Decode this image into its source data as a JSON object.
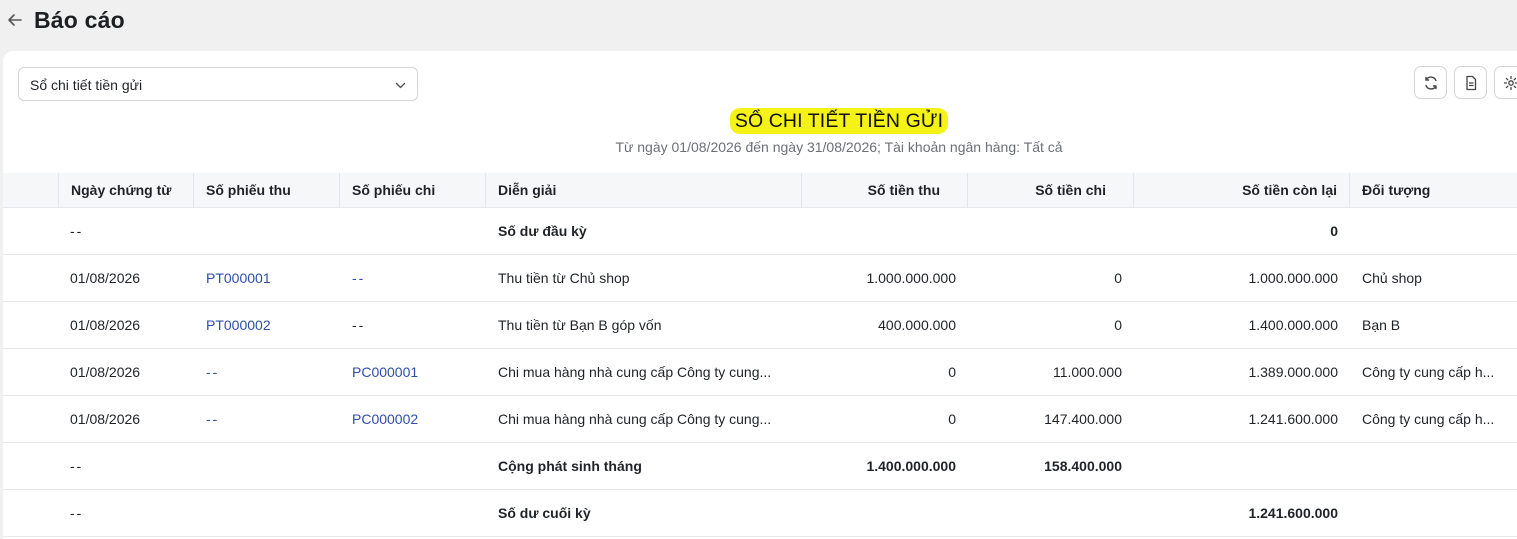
{
  "header": {
    "title": "Báo cáo"
  },
  "toolbar": {
    "report_select_value": "Sổ chi tiết tiền gửi"
  },
  "report": {
    "title": "SỔ CHI TIẾT TIỀN GỬI",
    "subtitle": "Từ ngày 01/08/2026 đến ngày 31/08/2026; Tài khoản ngân hàng: Tất cả",
    "highlight_color": "#f5f215"
  },
  "table": {
    "columns": {
      "date": "Ngày chứng từ",
      "receipt_no": "Số phiếu thu",
      "payment_no": "Số phiếu chi",
      "description": "Diễn giải",
      "amount_in": "Số tiền thu",
      "amount_out": "Số tiền chi",
      "balance": "Số tiền còn lại",
      "party": "Đối tượng"
    },
    "rows": [
      {
        "date": "--",
        "receipt_no": "",
        "payment_no": "",
        "description": "Số dư đầu kỳ",
        "amount_in": "",
        "amount_out": "",
        "balance": "0",
        "party": ""
      },
      {
        "date": "01/08/2026",
        "receipt_no": "PT000001",
        "payment_no": "--",
        "description": "Thu tiền từ Chủ shop",
        "amount_in": "1.000.000.000",
        "amount_out": "0",
        "balance": "1.000.000.000",
        "party": "Chủ shop"
      },
      {
        "date": "01/08/2026",
        "receipt_no": "PT000002",
        "payment_no": "--",
        "description": "Thu tiền từ Bạn B góp vốn",
        "amount_in": "400.000.000",
        "amount_out": "0",
        "balance": "1.400.000.000",
        "party": "Bạn B"
      },
      {
        "date": "01/08/2026",
        "receipt_no": "--",
        "payment_no": "PC000001",
        "description": "Chi mua hàng nhà cung cấp Công ty cung...",
        "amount_in": "0",
        "amount_out": "11.000.000",
        "balance": "1.389.000.000",
        "party": "Công ty cung cấp h..."
      },
      {
        "date": "01/08/2026",
        "receipt_no": "--",
        "payment_no": "PC000002",
        "description": "Chi mua hàng nhà cung cấp Công ty cung...",
        "amount_in": "0",
        "amount_out": "147.400.000",
        "balance": "1.241.600.000",
        "party": "Công ty cung cấp h..."
      },
      {
        "date": "--",
        "receipt_no": "",
        "payment_no": "",
        "description": "Cộng phát sinh tháng",
        "amount_in": "1.400.000.000",
        "amount_out": "158.400.000",
        "balance": "",
        "party": ""
      },
      {
        "date": "--",
        "receipt_no": "",
        "payment_no": "",
        "description": "Số dư cuối kỳ",
        "amount_in": "",
        "amount_out": "",
        "balance": "1.241.600.000",
        "party": ""
      }
    ]
  },
  "icons": {
    "back": "arrow-left-icon",
    "dropdown": "chevron-down-icon",
    "refresh": "refresh-icon",
    "export": "file-icon",
    "settings": "gear-icon"
  }
}
